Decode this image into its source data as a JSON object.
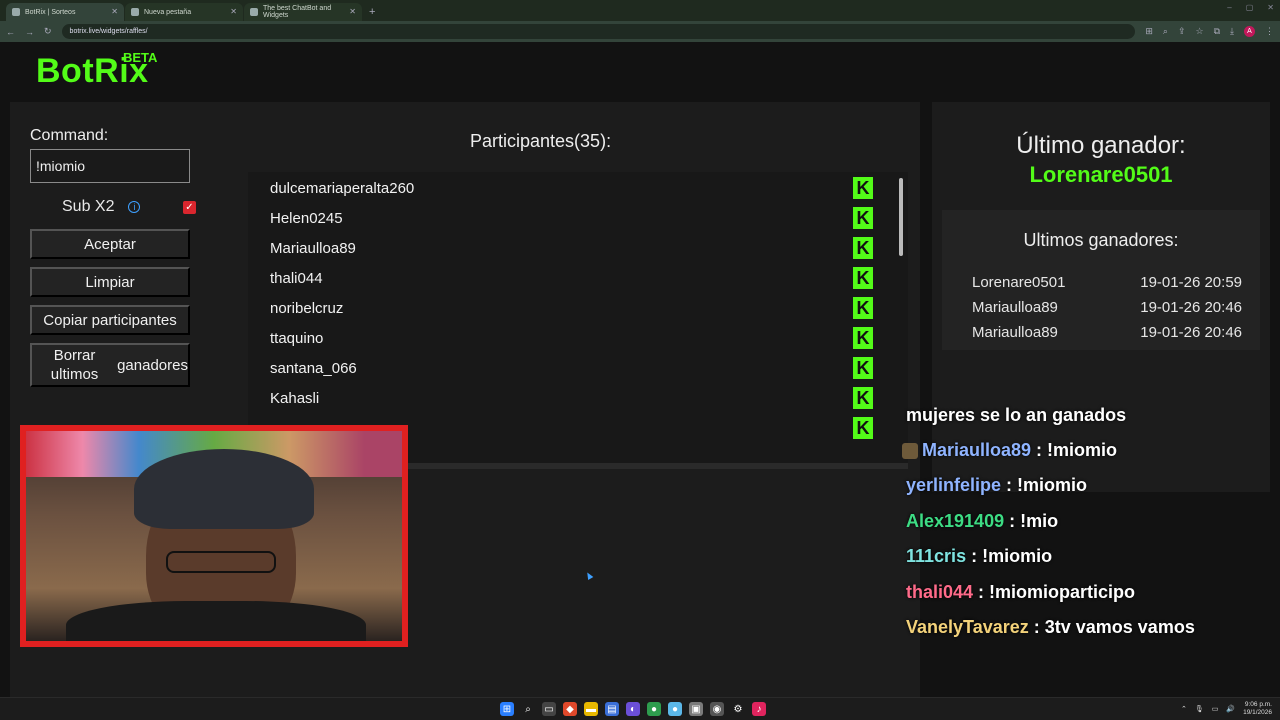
{
  "browser": {
    "tabs": [
      {
        "title": "BotRix | Sorteos",
        "active": true
      },
      {
        "title": "Nueva pestaña",
        "active": false
      },
      {
        "title": "The best ChatBot and Widgets",
        "active": false
      }
    ],
    "url": "botrix.live/widgets/raffles/"
  },
  "app": {
    "logo": "BotRix",
    "badge": "BETA"
  },
  "controls": {
    "command_label": "Command:",
    "command_value": "!miomio",
    "sub_label": "Sub X2",
    "sub_checked": true,
    "buttons": {
      "accept": "Aceptar",
      "clear": "Limpiar",
      "copy": "Copiar participantes",
      "delete_line1": "Borrar ultimos",
      "delete_line2": "ganadores"
    }
  },
  "participants": {
    "title": "Participantes(35):",
    "names": [
      "dulcemariaperalta260",
      "Helen0245",
      "Mariaulloa89",
      "thali044",
      "noribelcruz",
      "ttaquino",
      "santana_066",
      "Kahasli"
    ],
    "platform_icon": "kick-icon",
    "platform_letter": "K"
  },
  "winners": {
    "last_label": "Último ganador:",
    "last_name": "Lorenare0501",
    "recent_title": "Ultimos ganadores:",
    "rows": [
      {
        "name": "Lorenare0501",
        "time": "19-01-26 20:59"
      },
      {
        "name": "Mariaulloa89",
        "time": "19-01-26 20:46"
      },
      {
        "name": "Mariaulloa89",
        "time": "19-01-26 20:46"
      }
    ]
  },
  "chat": [
    {
      "user": "",
      "text": "mujeres se lo an ganados",
      "color": "#ffffff"
    },
    {
      "user": "Mariaulloa89",
      "text": " : !miomio",
      "color": "#8fb4ff"
    },
    {
      "user": "yerlinfelipe",
      "text": " : !miomio",
      "color": "#8fb4ff"
    },
    {
      "user": "Alex191409",
      "text": " : !mio",
      "color": "#3ddc84"
    },
    {
      "user": "111cris",
      "text": " : !miomio",
      "color": "#7fe3e0"
    },
    {
      "user": "thali044",
      "text": " : !miomioparticipo",
      "color": "#ff6b8a"
    },
    {
      "user": "VanelyTavarez",
      "text": " : 3tv vamos vamos",
      "color": "#f3d27a"
    }
  ],
  "taskbar": {
    "time": "9:06 p.m.",
    "date": "19/1/2026"
  },
  "colors": {
    "accent": "#53fc18",
    "checkbox": "#d9262e",
    "cam_border": "#e02020"
  }
}
